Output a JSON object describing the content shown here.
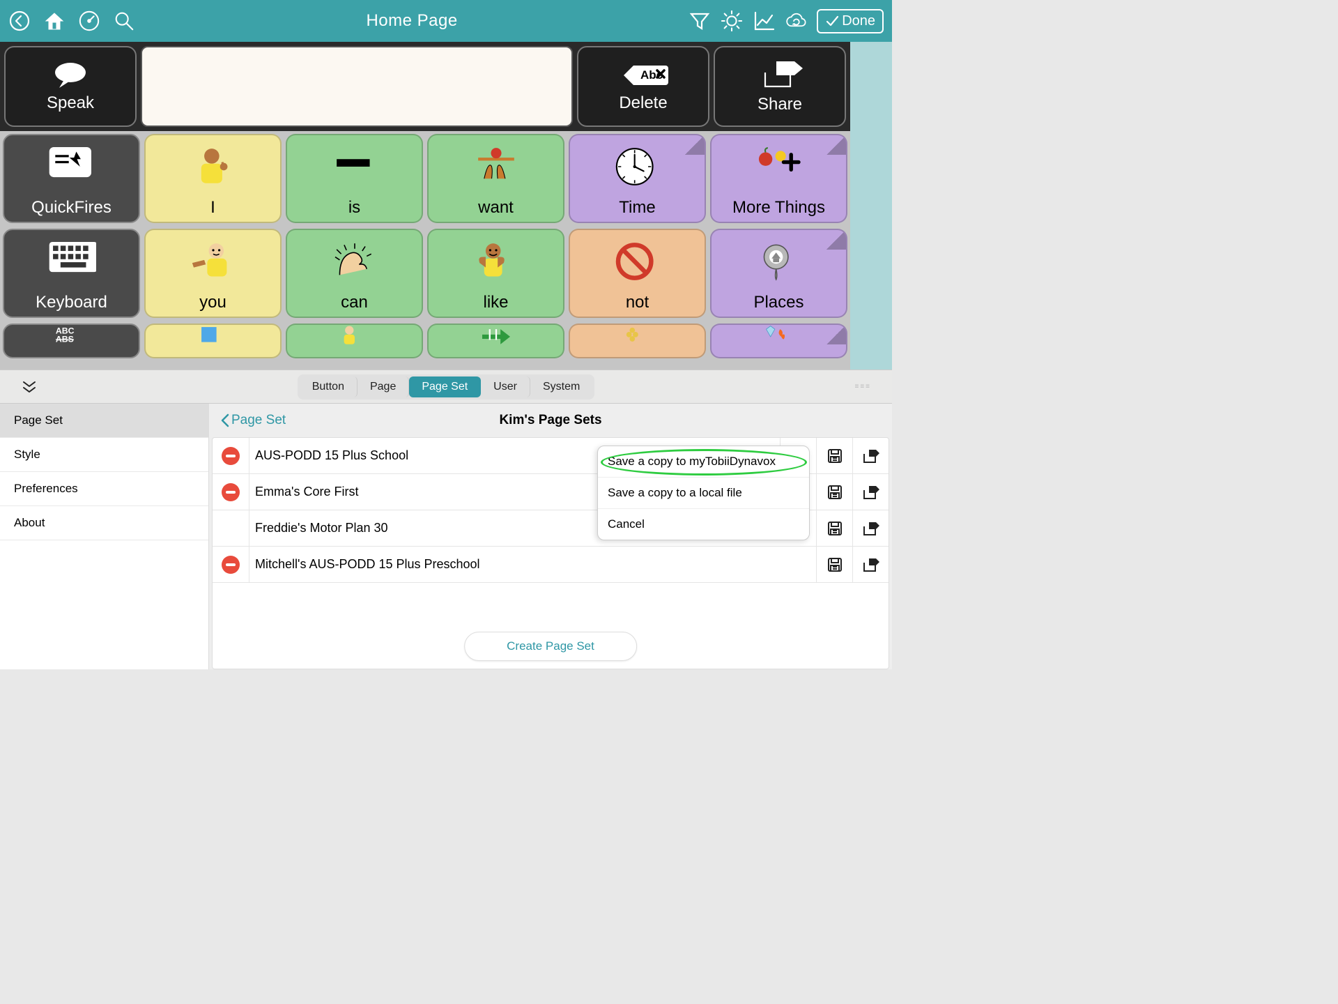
{
  "toolbar": {
    "title": "Home Page",
    "done": "Done"
  },
  "topRow": {
    "speak": "Speak",
    "delete": "Delete",
    "deleteIcon": "Abc ✕",
    "share": "Share"
  },
  "grid": {
    "row1": [
      {
        "label": "QuickFires",
        "color": "gray",
        "icon": "quickfires"
      },
      {
        "label": "I",
        "color": "yellow",
        "icon": "person-i"
      },
      {
        "label": "is",
        "color": "green",
        "icon": "equals"
      },
      {
        "label": "want",
        "color": "green",
        "icon": "want"
      },
      {
        "label": "Time",
        "color": "purple",
        "icon": "clock",
        "fold": true
      },
      {
        "label": "More Things",
        "color": "purple",
        "icon": "morethings",
        "fold": true
      }
    ],
    "row2": [
      {
        "label": "Keyboard",
        "color": "gray",
        "icon": "keyboard"
      },
      {
        "label": "you",
        "color": "yellow",
        "icon": "person-you"
      },
      {
        "label": "can",
        "color": "green",
        "icon": "arm"
      },
      {
        "label": "like",
        "color": "green",
        "icon": "like"
      },
      {
        "label": "not",
        "color": "orange",
        "icon": "no"
      },
      {
        "label": "Places",
        "color": "purple",
        "icon": "pin",
        "fold": true
      }
    ],
    "row3": [
      {
        "label": "",
        "color": "gray",
        "icon": "abc"
      },
      {
        "label": "",
        "color": "yellow",
        "icon": "square"
      },
      {
        "label": "",
        "color": "green",
        "icon": "child"
      },
      {
        "label": "",
        "color": "green",
        "icon": "arrow"
      },
      {
        "label": "",
        "color": "orange",
        "icon": "grapes"
      },
      {
        "label": "",
        "color": "purple",
        "icon": "gemfire",
        "fold": true
      }
    ]
  },
  "editor": {
    "tabs": [
      "Button",
      "Page",
      "Page Set",
      "User",
      "System"
    ],
    "activeTab": "Page Set",
    "sidebar": [
      "Page Set",
      "Style",
      "Preferences",
      "About"
    ],
    "sidebarActive": "Page Set",
    "back": "Page Set",
    "title": "Kim's Page Sets",
    "rows": [
      {
        "name": "AUS-PODD 15 Plus School",
        "del": true,
        "edit": true
      },
      {
        "name": "Emma's Core First",
        "del": true,
        "edit": false
      },
      {
        "name": "Freddie's Motor Plan 30",
        "del": false,
        "edit": false
      },
      {
        "name": "Mitchell's AUS-PODD 15 Plus Preschool",
        "del": true,
        "edit": false
      }
    ],
    "popover": [
      "Save a copy to myTobiiDynavox",
      "Save a copy to a local file",
      "Cancel"
    ],
    "create": "Create Page Set"
  }
}
